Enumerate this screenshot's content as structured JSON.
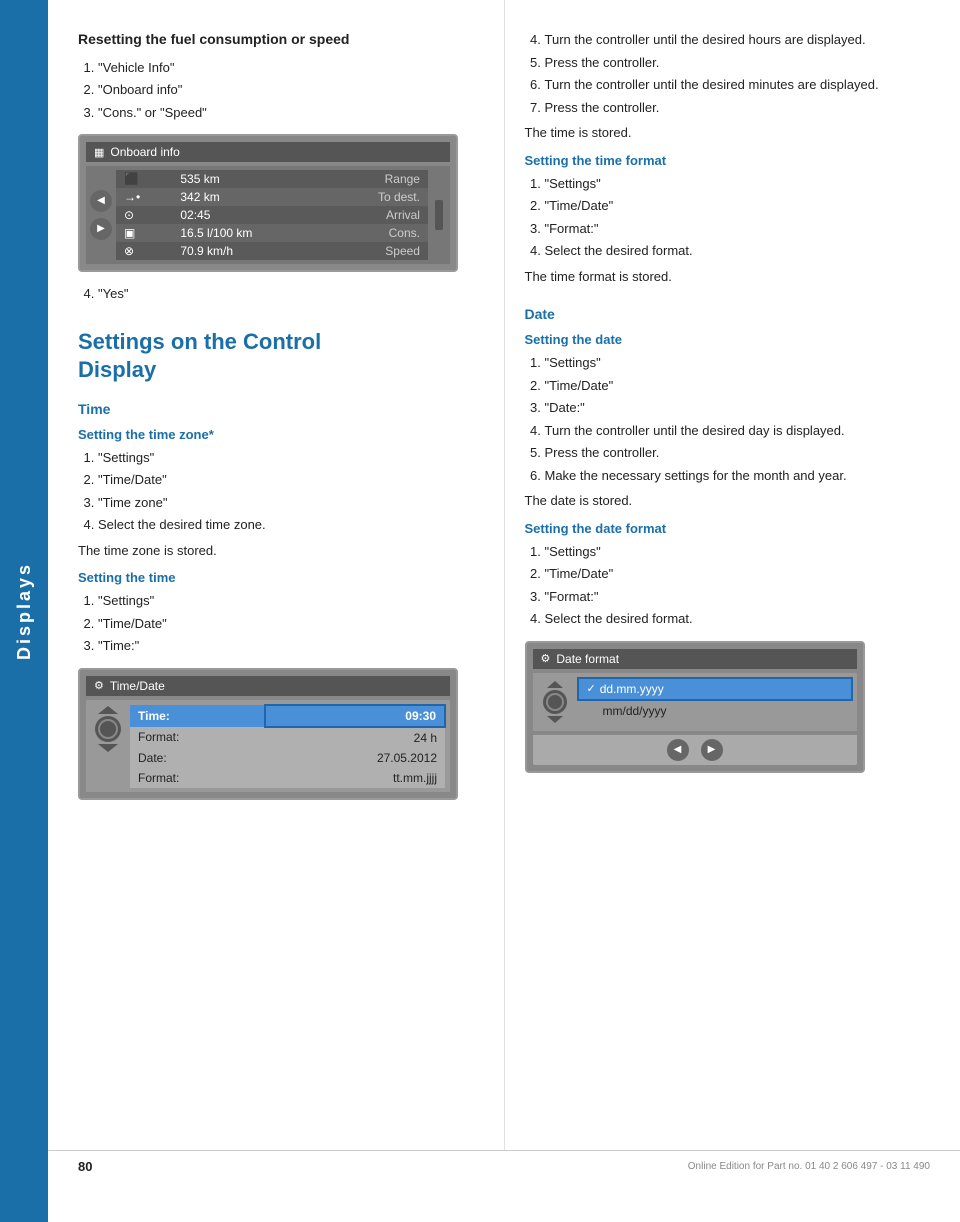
{
  "sidebar": {
    "label": "Displays"
  },
  "left_column": {
    "section1": {
      "title": "Resetting the fuel consumption or speed",
      "steps": [
        "\"Vehicle Info\"",
        "\"Onboard info\"",
        "\"Cons.\" or \"Speed\""
      ],
      "step4": "\"Yes\""
    },
    "onboard_screen": {
      "title": "Onboard info",
      "rows": [
        {
          "icon": "⬛",
          "value": "535 km",
          "label": "Range"
        },
        {
          "icon": "→•",
          "value": "342 km",
          "label": "To dest."
        },
        {
          "icon": "⊙",
          "value": "02:45",
          "label": "Arrival"
        },
        {
          "icon": "▣",
          "value": "16.5 l/100 km",
          "label": "Cons."
        },
        {
          "icon": "⊗",
          "value": "70.9 km/h",
          "label": "Speed"
        }
      ]
    },
    "section2": {
      "big_heading_line1": "Settings on the Control",
      "big_heading_line2": "Display",
      "time_heading": "Time",
      "time_zone_subheading": "Setting the time zone*",
      "time_zone_steps": [
        "\"Settings\"",
        "\"Time/Date\"",
        "\"Time zone\""
      ],
      "time_zone_step4": "Select the desired time zone.",
      "time_zone_note": "The time zone is stored.",
      "setting_time_subheading": "Setting the time",
      "setting_time_steps": [
        "\"Settings\"",
        "\"Time/Date\"",
        "\"Time:\""
      ]
    },
    "timedate_screen": {
      "title": "Time/Date",
      "rows": [
        {
          "label": "Time:",
          "value": "09:30",
          "highlighted": true
        },
        {
          "label": "Format:",
          "value": "24 h",
          "highlighted": false
        },
        {
          "label": "Date:",
          "value": "27.05.2012",
          "highlighted": false
        },
        {
          "label": "Format:",
          "value": "tt.mm.jjjj",
          "highlighted": false
        }
      ]
    }
  },
  "right_column": {
    "setting_time_continued": {
      "step4": "Turn the controller until the desired hours are displayed.",
      "step5": "Press the controller.",
      "step6": "Turn the controller until the desired minutes are displayed.",
      "step7": "Press the controller.",
      "note": "The time is stored."
    },
    "time_format": {
      "heading": "Setting the time format",
      "steps": [
        "\"Settings\"",
        "\"Time/Date\"",
        "\"Format:\""
      ],
      "step4": "Select the desired format.",
      "note": "The time format is stored."
    },
    "date_section": {
      "heading": "Date",
      "setting_date_subheading": "Setting the date",
      "setting_date_steps": [
        "\"Settings\"",
        "\"Time/Date\"",
        "\"Date:\""
      ],
      "step4": "Turn the controller until the desired day is displayed.",
      "step5": "Press the controller.",
      "step6": "Make the necessary settings for the month and year.",
      "note": "The date is stored."
    },
    "date_format": {
      "heading": "Setting the date format",
      "steps": [
        "\"Settings\"",
        "\"Time/Date\"",
        "\"Format:\""
      ],
      "step4": "Select the desired format.",
      "dateformat_screen": {
        "title": "Date format",
        "rows": [
          {
            "label": "dd.mm.yyyy",
            "selected": true
          },
          {
            "label": "mm/dd/yyyy",
            "selected": false
          }
        ]
      }
    }
  },
  "footer": {
    "page_number": "80",
    "note": "Online Edition for Part no. 01 40 2 606 497 - 03 11 490"
  }
}
